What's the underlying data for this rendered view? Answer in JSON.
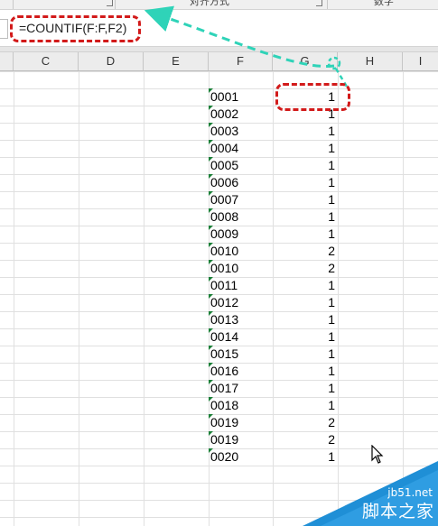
{
  "ribbon": {
    "group_alignment": "对齐方式",
    "group_number": "数字"
  },
  "formula_bar": {
    "formula": "=COUNTIF(F:F,F2)"
  },
  "columns": [
    "C",
    "D",
    "E",
    "F",
    "G",
    "H",
    "I"
  ],
  "rows": [
    {
      "f": "0001",
      "g": "1"
    },
    {
      "f": "0002",
      "g": "1"
    },
    {
      "f": "0003",
      "g": "1"
    },
    {
      "f": "0004",
      "g": "1"
    },
    {
      "f": "0005",
      "g": "1"
    },
    {
      "f": "0006",
      "g": "1"
    },
    {
      "f": "0007",
      "g": "1"
    },
    {
      "f": "0008",
      "g": "1"
    },
    {
      "f": "0009",
      "g": "1"
    },
    {
      "f": "0010",
      "g": "2"
    },
    {
      "f": "0010",
      "g": "2"
    },
    {
      "f": "0011",
      "g": "1"
    },
    {
      "f": "0012",
      "g": "1"
    },
    {
      "f": "0013",
      "g": "1"
    },
    {
      "f": "0014",
      "g": "1"
    },
    {
      "f": "0015",
      "g": "1"
    },
    {
      "f": "0016",
      "g": "1"
    },
    {
      "f": "0017",
      "g": "1"
    },
    {
      "f": "0018",
      "g": "1"
    },
    {
      "f": "0019",
      "g": "2"
    },
    {
      "f": "0019",
      "g": "2"
    },
    {
      "f": "0020",
      "g": "1"
    }
  ],
  "watermark": {
    "url": "jb51.net",
    "name": "脚本之家"
  },
  "colors": {
    "annotation_red": "#d21a1a",
    "annotation_teal": "#2fd3b8",
    "text_indicator_green": "#1a7f37",
    "watermark_blue": "#1f8fd6"
  }
}
